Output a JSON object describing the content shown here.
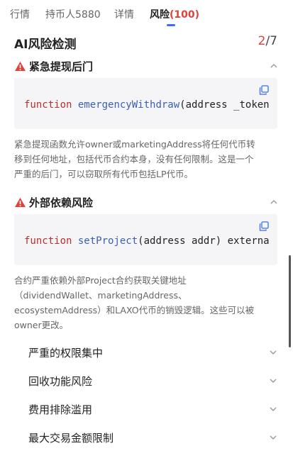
{
  "tabs": [
    {
      "label": "行情"
    },
    {
      "label": "持币人5880"
    },
    {
      "label": "详情"
    },
    {
      "label": "风险",
      "count": "(100)"
    }
  ],
  "section": {
    "title": "AI风险检测",
    "page_current": "2",
    "page_total": "/7"
  },
  "risks": [
    {
      "title": "紧急提现后门",
      "code": {
        "keyword": "function",
        "name": "emergencyWithdraw",
        "rest": "(address _token"
      },
      "description": [
        "紧急提现函数允许owner或marketingAddress将任何代币转",
        "移到任何地址，包括代币合约本身，没有任何限制。这是一个",
        "严重的后门，可以窃取所有代币包括LP代币。"
      ]
    },
    {
      "title": "外部依赖风险",
      "code": {
        "keyword": "function",
        "name": "setProject",
        "rest": "(address addr) externa"
      },
      "description": [
        "合约严重依赖外部Project合约获取关键地址",
        "（dividendWallet、marketingAddress、",
        "ecosystemAddress）和LAXO代币的销毁逻辑。这些可以被",
        "owner更改。"
      ]
    }
  ],
  "collapsed_items": [
    {
      "label": "严重的权限集中"
    },
    {
      "label": "回收功能风险"
    },
    {
      "label": "费用排除滥用"
    },
    {
      "label": "最大交易金额限制"
    }
  ],
  "colors": {
    "accent": "#3b6df2",
    "danger": "#e0413a"
  },
  "icons": {
    "warning": "warning-icon",
    "copy": "copy-icon",
    "expand": "chevron-up-icon",
    "collapse": "chevron-down-icon"
  }
}
